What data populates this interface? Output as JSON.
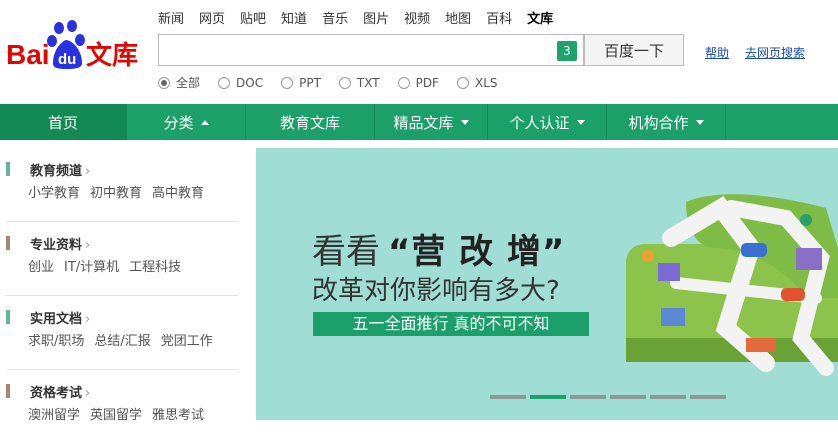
{
  "logo": {
    "bai": "Bai",
    "du": "du",
    "wenku": "文库"
  },
  "top_links": [
    "新闻",
    "网页",
    "贴吧",
    "知道",
    "音乐",
    "图片",
    "视频",
    "地图",
    "百科",
    "文库"
  ],
  "search": {
    "badge": "3",
    "button_label": "百度一下"
  },
  "help_link": "帮助",
  "web_search_link": "去网页搜索",
  "filters": [
    "全部",
    "DOC",
    "PPT",
    "TXT",
    "PDF",
    "XLS"
  ],
  "nav": [
    "首页",
    "分类",
    "教育文库",
    "精品文库",
    "个人认证",
    "机构合作"
  ],
  "categories": [
    {
      "title": "教育频道",
      "links": [
        "小学教育",
        "初中教育",
        "高中教育"
      ],
      "color": "#5db89a"
    },
    {
      "title": "专业资料",
      "links": [
        "创业",
        "IT/计算机",
        "工程科技"
      ],
      "color": "#a6876f"
    },
    {
      "title": "实用文档",
      "links": [
        "求职/职场",
        "总结/汇报",
        "党团工作"
      ],
      "color": "#5db89a"
    },
    {
      "title": "资格考试",
      "links": [
        "澳洲留学",
        "英国留学",
        "雅思考试"
      ],
      "color": "#a6876f"
    }
  ],
  "banner": {
    "line1_prefix": "看看",
    "line1_highlight": "“营 改 增”",
    "line2": "改革对你影响有多大?",
    "tag": "五一全面推行  真的不可不知",
    "slide_count": 6,
    "active_slide": 2
  },
  "colors": {
    "brand_green": "#1aa068",
    "banner_bg": "#a0ddd5",
    "baidu_red": "#e10602",
    "baidu_blue": "#2932e1"
  }
}
